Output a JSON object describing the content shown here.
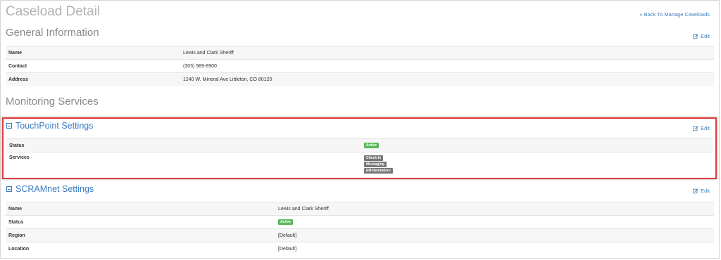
{
  "page_title": "Caseload Detail",
  "back_link": "« Back To Manage Caseloads",
  "edit_label": "Edit",
  "general": {
    "title": "General Information",
    "rows": [
      {
        "label": "Name",
        "value": "Lewis and Clark Sheriff"
      },
      {
        "label": "Contact",
        "value": "(303) 989-8900"
      },
      {
        "label": "Address",
        "value": "1240 W. Mineral Ave Littleton, CO 80120"
      }
    ]
  },
  "monitoring": {
    "title": "Monitoring Services"
  },
  "touchpoint": {
    "title": "TouchPoint Settings",
    "status_label": "Status",
    "status_value": "Active",
    "services_label": "Services",
    "services": [
      "Check-In",
      "Messaging",
      "EM Reminders"
    ]
  },
  "scramnet": {
    "title": "SCRAMnet Settings",
    "rows": [
      {
        "label": "Name",
        "value": "Lewis and Clark Sheriff"
      },
      {
        "label": "Status",
        "value": "Active"
      },
      {
        "label": "Region",
        "value": "[Default]"
      },
      {
        "label": "Location",
        "value": "[Default]"
      }
    ]
  },
  "colors": {
    "link": "#3f7fbf",
    "highlight_border": "#e03a3a",
    "badge_active": "#5cb85c",
    "badge_service": "#777777"
  }
}
